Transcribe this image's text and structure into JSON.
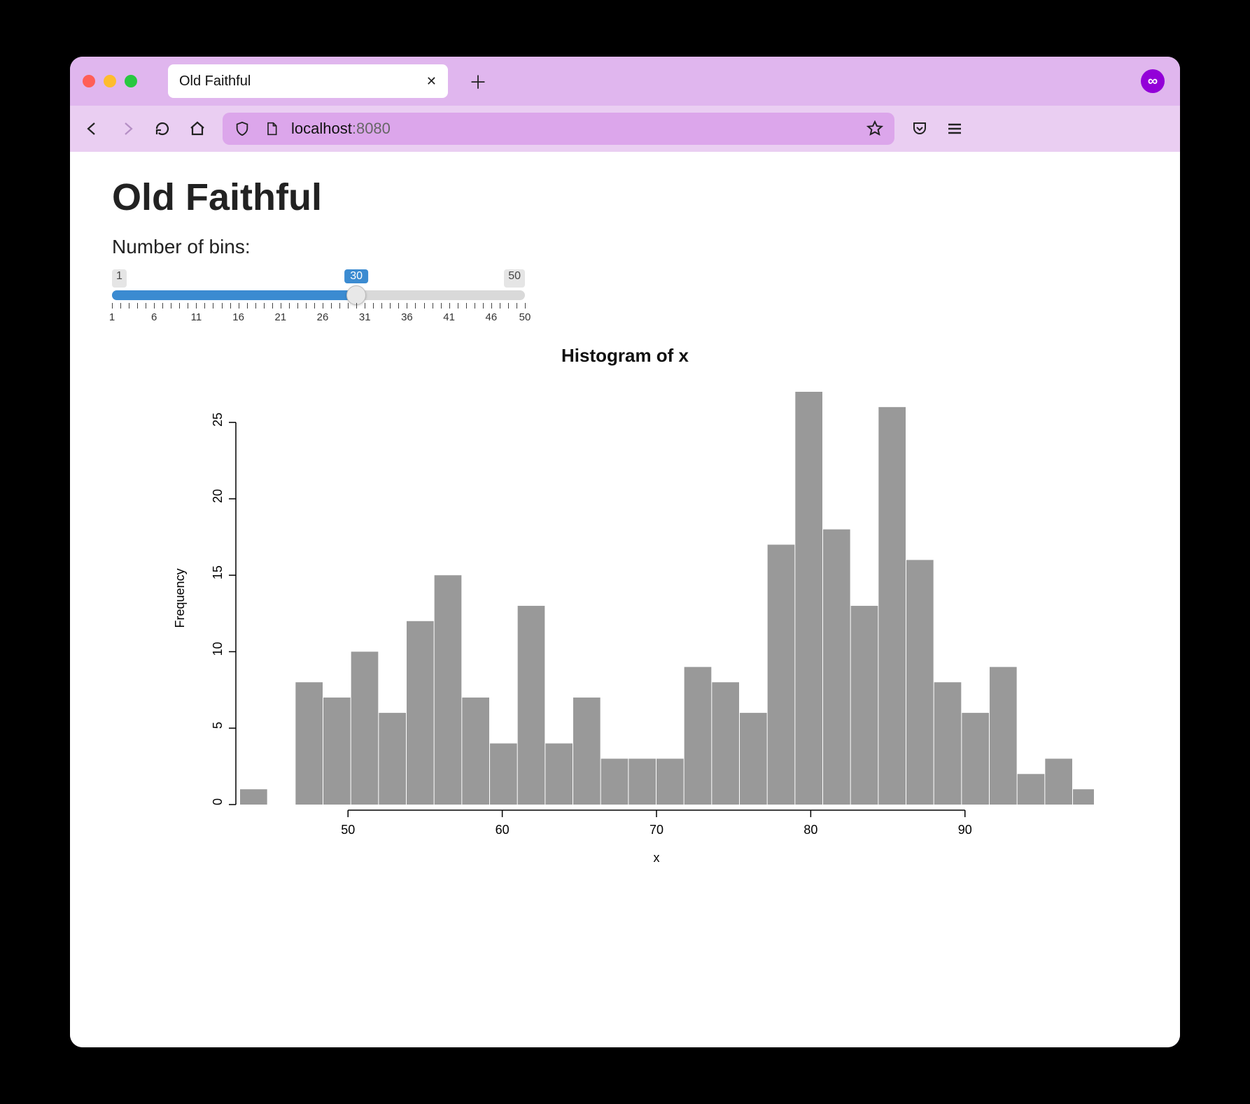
{
  "browser": {
    "tab_title": "Old Faithful",
    "tab_close": "✕",
    "newtab": "＋",
    "url_host": "localhost",
    "url_port": ":8080",
    "extension_glyph": "∞"
  },
  "page": {
    "title": "Old Faithful",
    "slider": {
      "label": "Number of bins:",
      "min": 1,
      "max": 50,
      "value": 30,
      "ticks_major": [
        1,
        6,
        11,
        16,
        21,
        26,
        31,
        36,
        41,
        46,
        50
      ]
    }
  },
  "chart_data": {
    "type": "bar",
    "title": "Histogram of x",
    "xlabel": "x",
    "ylabel": "Frequency",
    "xlim": [
      43,
      97
    ],
    "ylim": [
      0,
      27
    ],
    "x_ticks": [
      50,
      60,
      70,
      80,
      90
    ],
    "y_ticks": [
      0,
      5,
      10,
      15,
      20,
      25
    ],
    "bin_width": 1.8,
    "bin_start": 43,
    "values": [
      1,
      0,
      8,
      7,
      10,
      6,
      12,
      15,
      7,
      4,
      13,
      4,
      7,
      3,
      3,
      3,
      9,
      8,
      6,
      17,
      27,
      18,
      13,
      26,
      16,
      8,
      6,
      9,
      2,
      3,
      1
    ]
  }
}
